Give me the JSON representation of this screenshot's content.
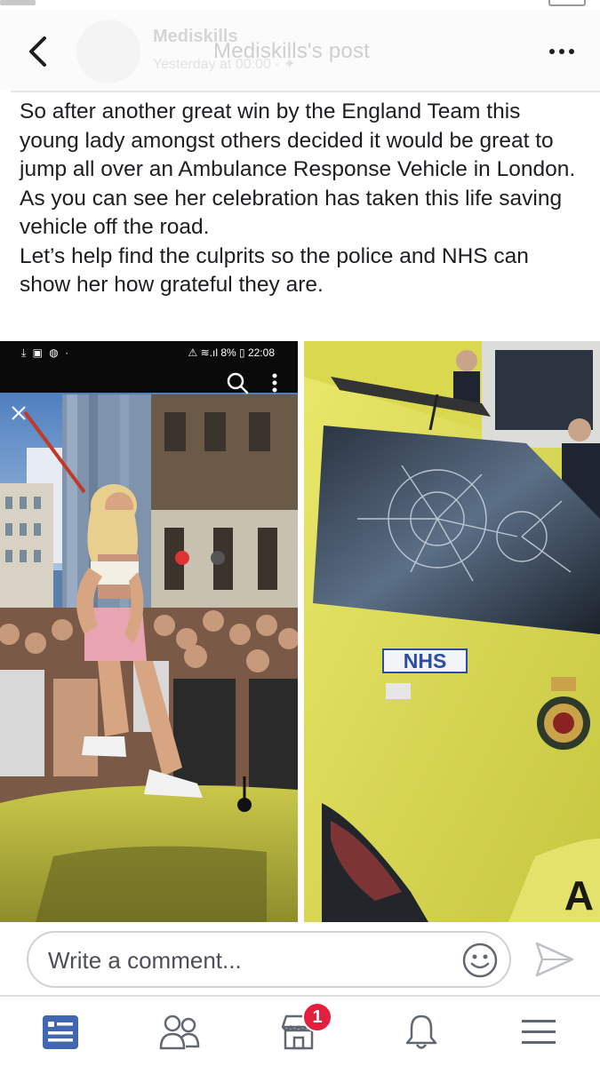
{
  "header": {
    "title": "Mediskills's post",
    "ghost_name": "Mediskills",
    "ghost_sub": "Yesterday at 00:00 · ✦"
  },
  "post": {
    "paragraphs": [
      "So after another great win by the England Team this young lady amongst others decided it would be great to jump all over an Ambulance Response Vehicle in London.",
      "As you can see her celebration has taken this life saving vehicle off the road.",
      "Let’s help find the culprits so the police and NHS can show her how grateful they are."
    ]
  },
  "photo_left": {
    "status_left": "⤓ ▣ ◍ ·",
    "status_right": "⚠ ≋.ıl 8% ▯ 22:08",
    "description_icon": "close-icon"
  },
  "photo_right": {
    "hood_text": "NHS",
    "plate_text": "A"
  },
  "comment": {
    "placeholder": "Write a comment..."
  },
  "tabs": [
    {
      "name": "news-feed",
      "icon": "news-feed-icon",
      "active": true
    },
    {
      "name": "friends",
      "icon": "friends-icon",
      "active": false
    },
    {
      "name": "marketplace",
      "icon": "marketplace-icon",
      "active": false,
      "badge": "1"
    },
    {
      "name": "notifications",
      "icon": "bell-icon",
      "active": false
    },
    {
      "name": "menu",
      "icon": "menu-icon",
      "active": false
    }
  ],
  "colors": {
    "accent": "#4267b2",
    "badge": "#e41e3f",
    "text": "#1c1e21",
    "icon_gray": "#606770"
  }
}
